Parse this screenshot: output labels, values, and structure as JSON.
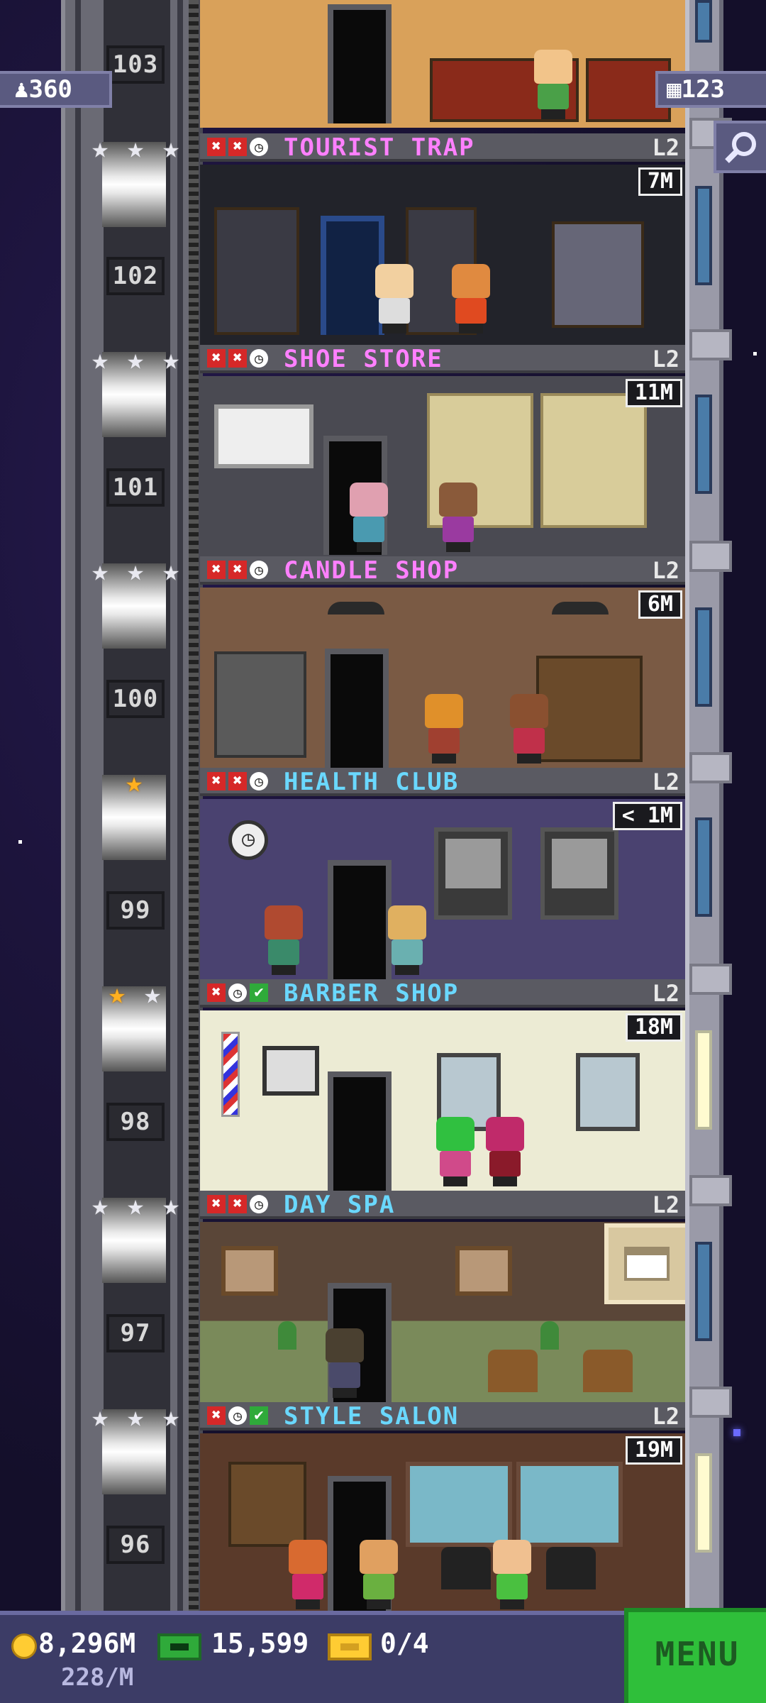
{
  "top": {
    "population": "360",
    "population_icon": "person-icon",
    "floors": "123",
    "floors_icon": "building-icon",
    "search_icon": "magnifier-icon"
  },
  "floors": [
    {
      "number": "103"
    },
    {
      "number": "102",
      "name": "TOURIST TRAP",
      "level": "L2",
      "stock": "7M",
      "status": [
        "x",
        "x",
        "clock"
      ],
      "stars": [
        "silver",
        "silver",
        "silver"
      ]
    },
    {
      "number": "101",
      "name": "SHOE STORE",
      "level": "L2",
      "stock": "11M",
      "status": [
        "x",
        "x",
        "clock"
      ],
      "stars": [
        "silver",
        "silver",
        "silver"
      ]
    },
    {
      "number": "100",
      "name": "CANDLE SHOP",
      "level": "L2",
      "stock": "6M",
      "status": [
        "x",
        "x",
        "clock"
      ],
      "stars": [
        "silver",
        "silver",
        "silver"
      ]
    },
    {
      "number": "99",
      "name": "HEALTH CLUB",
      "level": "L2",
      "stock": "< 1M",
      "status": [
        "x",
        "x",
        "clock"
      ],
      "stars": [
        "gold"
      ]
    },
    {
      "number": "98",
      "name": "BARBER SHOP",
      "level": "L2",
      "stock": "18M",
      "status": [
        "x",
        "clock",
        "check"
      ],
      "stars": [
        "gold",
        "silver"
      ]
    },
    {
      "number": "97",
      "name": "DAY SPA",
      "level": "L2",
      "status": [
        "x",
        "x",
        "clock"
      ],
      "stars": [
        "silver",
        "silver",
        "silver"
      ]
    },
    {
      "number": "96",
      "name": "STYLE SALON",
      "level": "L2",
      "stock": "19M",
      "status": [
        "x",
        "clock",
        "check"
      ],
      "stars": [
        "silver",
        "silver",
        "silver"
      ]
    }
  ],
  "bottom": {
    "coins": "8,296M",
    "coins_rate": "228/M",
    "bux": "15,599",
    "tickets": "0/4",
    "menu_label": "MENU"
  },
  "colors": {
    "sky": "#140f2a",
    "name_pink": "#ff80ff",
    "name_blue": "#6ad8ff",
    "menu_green": "#2fbf3a"
  }
}
